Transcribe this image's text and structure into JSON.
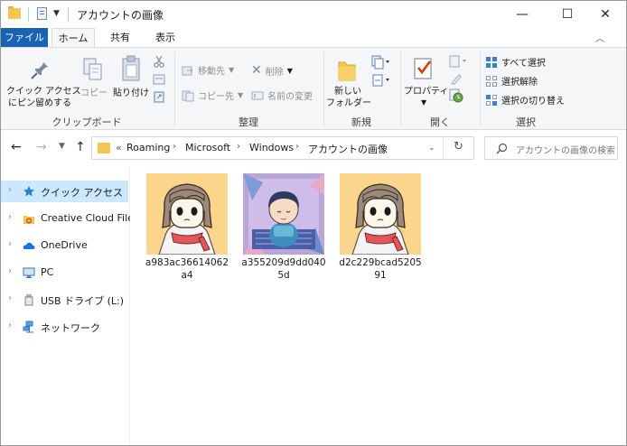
{
  "window": {
    "title": "アカウントの画像",
    "controls": {
      "minimize": "—",
      "maximize": "☐",
      "close": "✕"
    }
  },
  "ribbon_tabs": {
    "file": "ファイル",
    "home": "ホーム",
    "share": "共有",
    "view": "表示"
  },
  "ribbon": {
    "clipboard": {
      "group_label": "クリップボード",
      "pin_quick_access": [
        "クイック アクセス",
        "にピン留めする"
      ],
      "copy": "コピー",
      "paste": "貼り付け"
    },
    "organize": {
      "group_label": "整理",
      "move_to": "移動先",
      "copy_to": "コピー先",
      "delete": "削除",
      "rename": "名前の変更"
    },
    "new": {
      "group_label": "新規",
      "new_folder": [
        "新しい",
        "フォルダー"
      ]
    },
    "open": {
      "group_label": "開く",
      "properties": "プロパティ"
    },
    "select": {
      "group_label": "選択",
      "select_all": "すべて選択",
      "select_none": "選択解除",
      "invert_selection": "選択の切り替え"
    }
  },
  "address_bar": {
    "overflow": "«",
    "path": [
      "Roaming",
      "Microsoft",
      "Windows",
      "アカウントの画像"
    ]
  },
  "search": {
    "placeholder": "アカウントの画像の検索"
  },
  "nav_pane": {
    "items": [
      {
        "label": "クイック アクセス",
        "icon": "star-icon",
        "selected": true
      },
      {
        "label": "Creative Cloud Files",
        "icon": "creative-cloud-icon",
        "selected": false
      },
      {
        "label": "OneDrive",
        "icon": "onedrive-cloud-icon",
        "selected": false
      },
      {
        "label": "PC",
        "icon": "monitor-icon",
        "selected": false
      },
      {
        "label": "USB ドライブ (L:)",
        "icon": "usb-drive-icon",
        "selected": false
      },
      {
        "label": "ネットワーク",
        "icon": "network-icon",
        "selected": false
      }
    ]
  },
  "files": [
    {
      "name": "a983ac36614062a4",
      "thumbnail": "girl-avatar"
    },
    {
      "name": "a355209d9dd0405d",
      "thumbnail": "boy-illustration"
    },
    {
      "name": "d2c229bcad520591",
      "thumbnail": "girl-avatar"
    }
  ],
  "colors": {
    "accent": "#1a62b3",
    "selection": "#cce8ff",
    "ribbon_bg": "#f5f6f7",
    "folder": "#f4c64f",
    "avatar_bg": "#fcd58c"
  }
}
